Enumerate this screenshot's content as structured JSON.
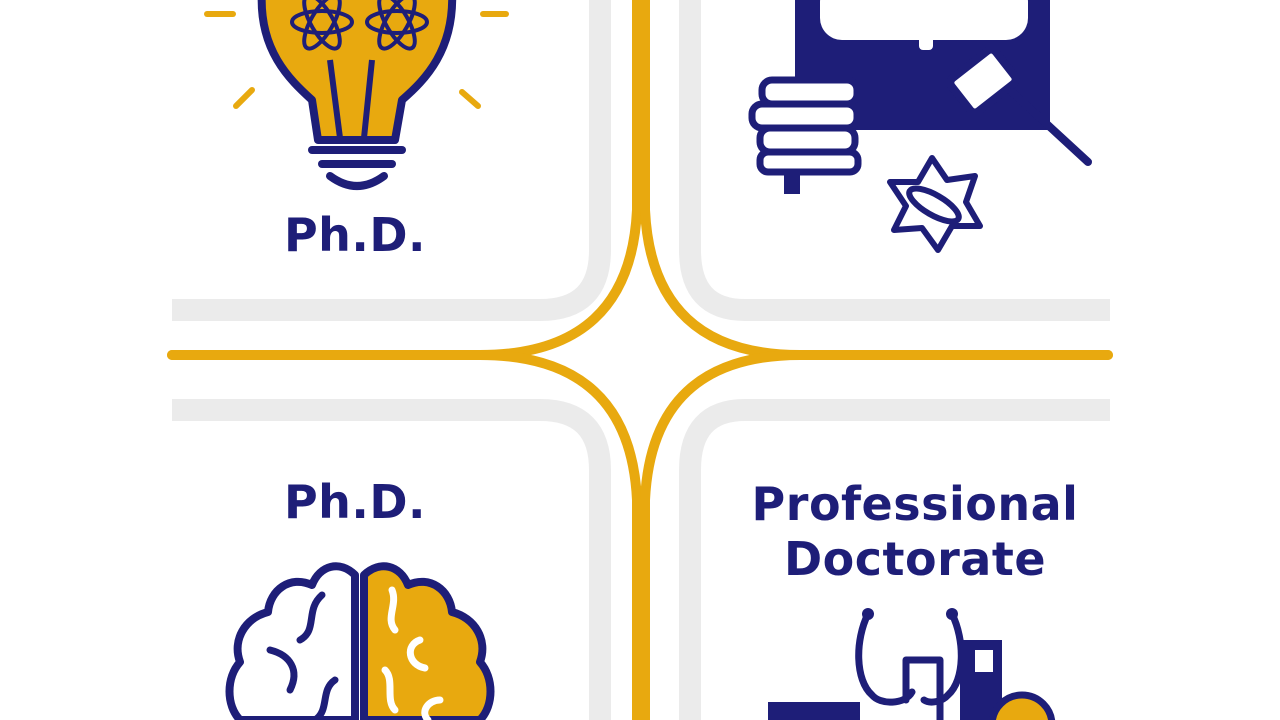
{
  "quadrants": {
    "top_left": {
      "label": "Ph.D.",
      "icon": "lightbulb-atom-icon"
    },
    "top_right": {
      "icon": "law-books-gavel-icon"
    },
    "bottom_left": {
      "label": "Ph.D.",
      "icon": "brain-icon"
    },
    "bottom_right": {
      "label_line1": "Professional",
      "label_line2": "Doctorate",
      "icon": "stethoscope-icon"
    }
  },
  "colors": {
    "navy": "#1e1e78",
    "gold": "#e8a90f",
    "card_border": "#ececec",
    "background": "#ffffff"
  }
}
